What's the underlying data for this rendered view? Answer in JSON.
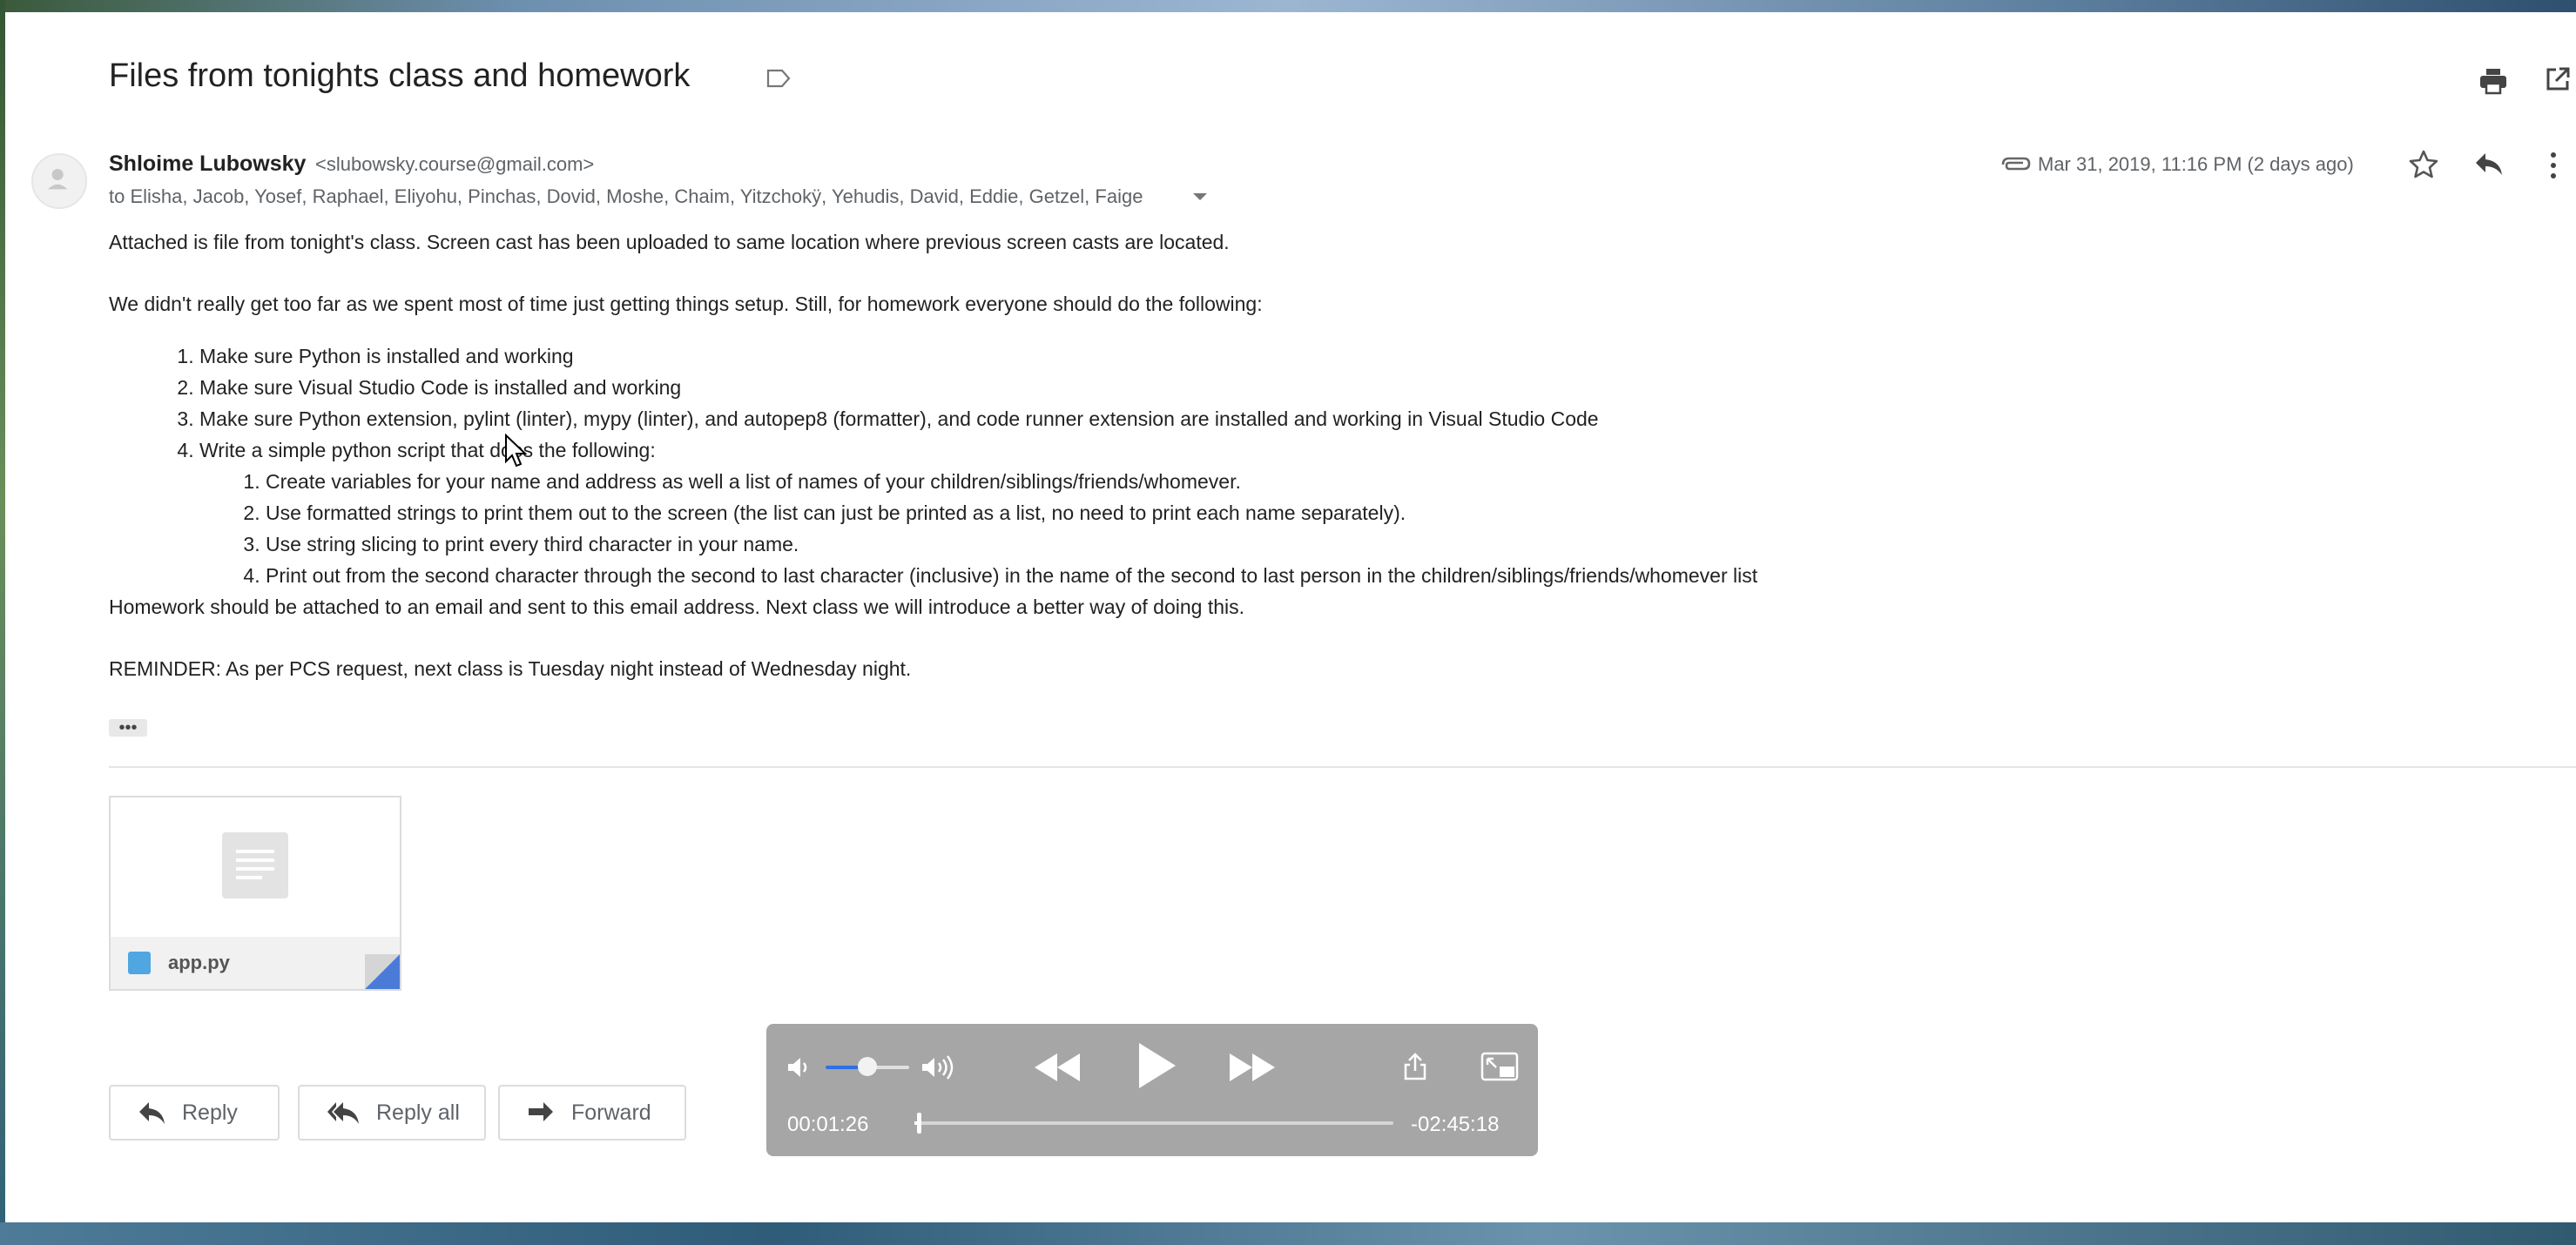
{
  "email": {
    "subject": "Files from tonights class and homework",
    "sender": {
      "name": "Shloime Lubowsky",
      "email": "<slubowsky.course@gmail.com>"
    },
    "recipients": "to Elisha, Jacob, Yosef, Raphael, Eliyohu, Pinchas, Dovid, Moshe, Chaim, Yitzchokÿ, Yehudis, David, Eddie, Getzel, Faige",
    "date": "Mar 31, 2019, 11:16 PM (2 days ago)",
    "body": {
      "p1": "Attached is file from tonight's class. Screen cast has been uploaded to same location where previous screen casts are located.",
      "p2": "We didn't really get too far as we spent most of time just getting things setup. Still, for homework everyone should do the following:",
      "list": [
        "Make sure Python is installed and working",
        "Make sure Visual Studio Code is installed and working",
        "Make sure Python extension, pylint (linter), mypy (linter), and autopep8 (formatter), and code runner extension are installed and working in Visual Studio Code",
        "Write a simple python script that does the following:"
      ],
      "sublist": [
        "Create variables for your name and address as well a list of names of your children/siblings/friends/whomever.",
        "Use formatted strings to print them out to the screen (the list can just be printed as a list, no need to print each name separately).",
        "Use string slicing to print every third character in your name.",
        "Print out from the second character through the second to last character (inclusive) in the name of the second to last person in the children/siblings/friends/whomever list"
      ],
      "p3": "Homework should be attached to an email and sent to this email address. Next class we will introduce a better way of doing this.",
      "p4": "REMINDER: As per PCS request, next class is Tuesday night instead of Wednesday night."
    },
    "ellipsis": "•••",
    "attachment": {
      "filename": "app.py"
    },
    "actions": {
      "reply": "Reply",
      "reply_all": "Reply all",
      "forward": "Forward"
    }
  },
  "player": {
    "current_time": "00:01:26",
    "remaining_time": "-02:45:18",
    "volume_fraction": 0.5,
    "progress_fraction": 0.0085
  },
  "colors": {
    "accent_blue": "#2f6fe6",
    "player_bg": "#a6a6a6",
    "muted_text": "#5f6368",
    "file_icon": "#4fa6e0"
  },
  "icons": [
    "label-icon",
    "print-icon",
    "popout-icon",
    "avatar-icon",
    "attachment-clip-icon",
    "star-icon",
    "reply-icon",
    "more-vert-icon",
    "chevron-down-icon",
    "document-icon",
    "reply-all-icon",
    "forward-icon",
    "volume-low-icon",
    "volume-high-icon",
    "rewind-icon",
    "play-icon",
    "fast-forward-icon",
    "share-icon",
    "pip-icon",
    "mouse-cursor-icon"
  ]
}
